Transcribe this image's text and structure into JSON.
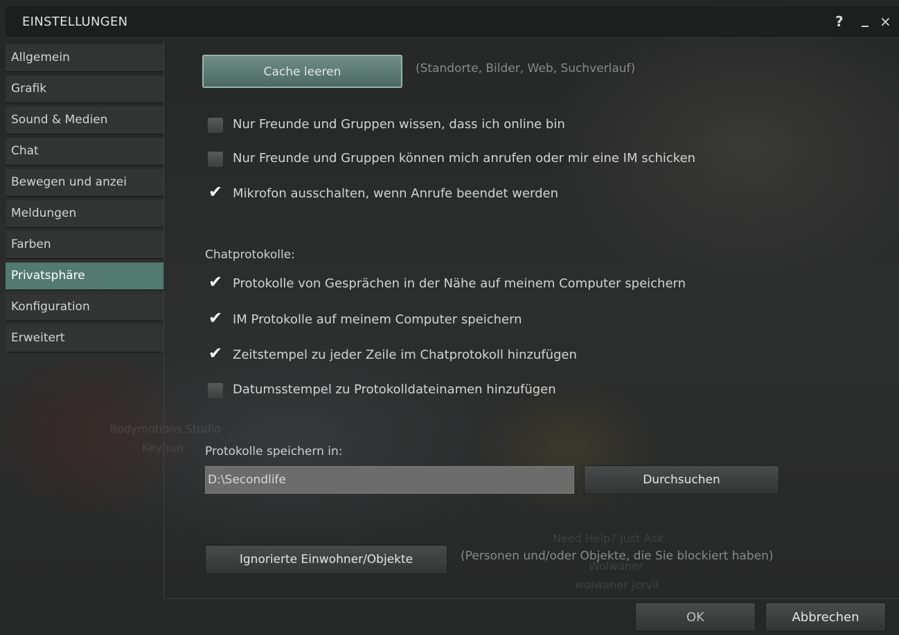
{
  "window": {
    "title": "EINSTELLUNGEN",
    "help_icon": "?",
    "minimize_icon": "_",
    "close_icon": "×"
  },
  "sidebar": {
    "items": [
      {
        "label": "Allgemein",
        "active": false
      },
      {
        "label": "Grafik",
        "active": false
      },
      {
        "label": "Sound & Medien",
        "active": false
      },
      {
        "label": "Chat",
        "active": false
      },
      {
        "label": "Bewegen und anzei",
        "active": false
      },
      {
        "label": "Meldungen",
        "active": false
      },
      {
        "label": "Farben",
        "active": false
      },
      {
        "label": "Privatsphäre",
        "active": true
      },
      {
        "label": "Konfiguration",
        "active": false
      },
      {
        "label": "Erweitert",
        "active": false
      }
    ]
  },
  "cache": {
    "button_label": "Cache leeren",
    "hint": "(Standorte, Bilder, Web, Suchverlauf)"
  },
  "privacy_options": [
    {
      "label": "Nur Freunde und Gruppen wissen, dass ich online bin",
      "checked": false
    },
    {
      "label": "Nur Freunde und Gruppen können mich anrufen oder mir eine IM schicken",
      "checked": false
    },
    {
      "label": "Mikrofon ausschalten, wenn Anrufe beendet werden",
      "checked": true
    }
  ],
  "chatlogs": {
    "heading": "Chatprotokolle:",
    "options": [
      {
        "label": "Protokolle von Gesprächen in der Nähe auf meinem Computer speichern",
        "checked": true
      },
      {
        "label": "IM Protokolle auf meinem Computer speichern",
        "checked": true
      },
      {
        "label": "Zeitstempel zu jeder Zeile im Chatprotokoll hinzufügen",
        "checked": true
      },
      {
        "label": "Datumsstempel zu Protokolldateinamen hinzufügen",
        "checked": false
      }
    ]
  },
  "save_location": {
    "label": "Protokolle speichern in:",
    "path": "D:\\Secondlife",
    "browse_label": "Durchsuchen"
  },
  "blocked": {
    "button_label": "Ignorierte Einwohner/Objekte",
    "hint": "(Personen und/oder Objekte, die Sie blockiert haben)"
  },
  "footer": {
    "ok_label": "OK",
    "cancel_label": "Abbrechen"
  },
  "background_texts": {
    "studio": "Bodymotions Studio",
    "person": "Keyhun",
    "help": "Need Help? Just Ask",
    "name": "Wolwaner",
    "username": "wolwaner jervil"
  },
  "colors": {
    "accent": "#527a70",
    "cache_button": "#5f7d76",
    "panel_bg": "#262727"
  }
}
